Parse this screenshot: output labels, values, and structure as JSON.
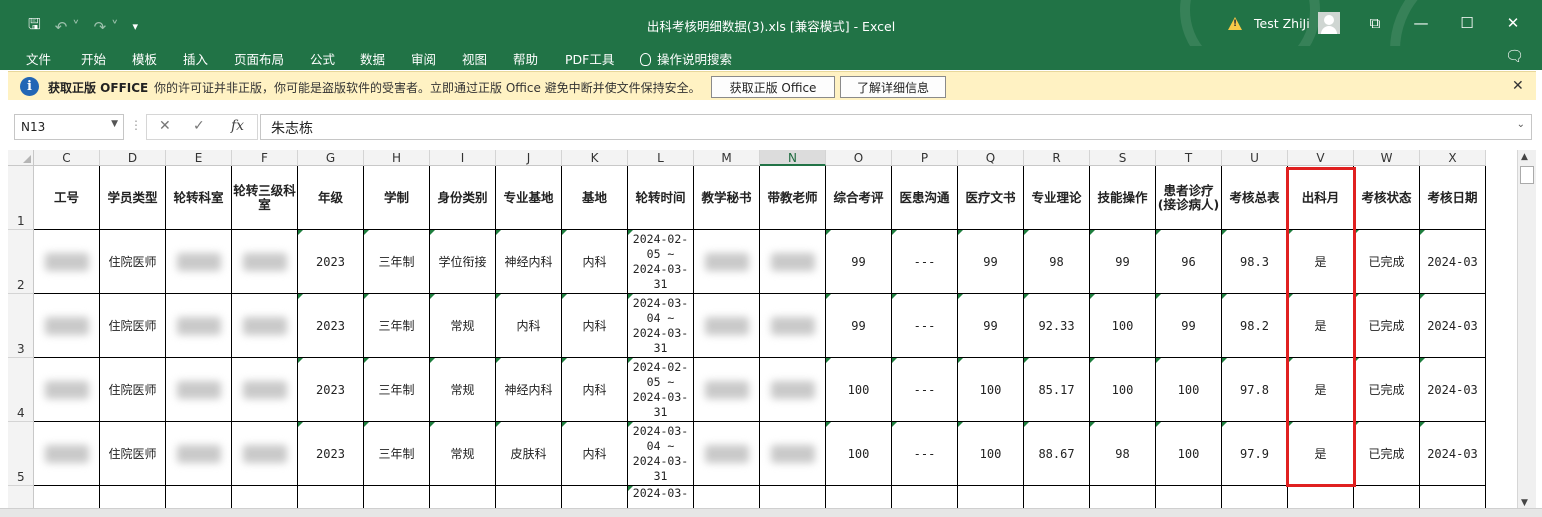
{
  "window": {
    "title": "出科考核明细数据(3).xls  [兼容模式]  -  Excel",
    "user": "Test ZhiJi"
  },
  "menu": [
    "文件",
    "开始",
    "模板",
    "插入",
    "页面布局",
    "公式",
    "数据",
    "审阅",
    "视图",
    "帮助",
    "PDF工具",
    "操作说明搜索"
  ],
  "infobar": {
    "title": "获取正版 OFFICE",
    "message": "你的许可证并非正版，你可能是盗版软件的受害者。立即通过正版 Office 避免中断并使文件保持安全。",
    "btn_get": "获取正版 Office",
    "btn_learn": "了解详细信息"
  },
  "formula": {
    "name_box": "N13",
    "value": "朱志栋"
  },
  "columns": [
    "C",
    "D",
    "E",
    "F",
    "G",
    "H",
    "I",
    "J",
    "K",
    "L",
    "M",
    "N",
    "O",
    "P",
    "Q",
    "R",
    "S",
    "T",
    "U",
    "V",
    "W",
    "X"
  ],
  "selected_column": "N",
  "row_numbers": [
    "1",
    "2",
    "3",
    "4",
    "5"
  ],
  "headers": [
    "工号",
    "学员类型",
    "轮转科室",
    "轮转三级科室",
    "年级",
    "学制",
    "身份类别",
    "专业基地",
    "基地",
    "轮转时间",
    "教学秘书",
    "带教老师",
    "综合考评",
    "医患沟通",
    "医疗文书",
    "专业理论",
    "技能操作",
    "患者诊疗(接诊病人)",
    "考核总表",
    "出科月",
    "考核状态",
    "考核日期"
  ],
  "rows": [
    [
      "",
      "住院医师",
      "",
      "",
      "2023",
      "三年制",
      "学位衔接",
      "神经内科",
      "内科",
      "2024-02-05 ~ 2024-03-31",
      "",
      "",
      "99",
      "---",
      "99",
      "98",
      "99",
      "96",
      "98.3",
      "是",
      "已完成",
      "2024-03"
    ],
    [
      "",
      "住院医师",
      "",
      "",
      "2023",
      "三年制",
      "常规",
      "内科",
      "内科",
      "2024-03-04 ~ 2024-03-31",
      "",
      "",
      "99",
      "---",
      "99",
      "92.33",
      "100",
      "99",
      "98.2",
      "是",
      "已完成",
      "2024-03"
    ],
    [
      "",
      "住院医师",
      "",
      "",
      "2023",
      "三年制",
      "常规",
      "神经内科",
      "内科",
      "2024-02-05 ~ 2024-03-31",
      "",
      "",
      "100",
      "---",
      "100",
      "85.17",
      "100",
      "100",
      "97.8",
      "是",
      "已完成",
      "2024-03"
    ],
    [
      "",
      "住院医师",
      "",
      "",
      "2023",
      "三年制",
      "常规",
      "皮肤科",
      "内科",
      "2024-03-04 ~ 2024-03-31",
      "",
      "",
      "100",
      "---",
      "100",
      "88.67",
      "98",
      "100",
      "97.9",
      "是",
      "已完成",
      "2024-03"
    ],
    [
      "",
      "",
      "",
      "",
      "",
      "",
      "",
      "",
      "",
      "2024-03-",
      "",
      "",
      "",
      "",
      "",
      "",
      "",
      "",
      "",
      "",
      "",
      ""
    ]
  ],
  "highlight_color": "#e02020",
  "excel_green": "#217346"
}
